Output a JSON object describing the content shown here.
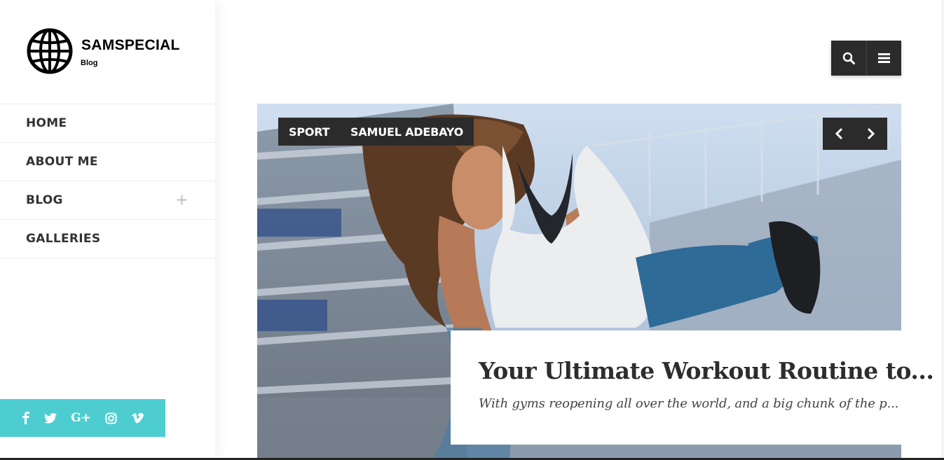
{
  "brand": {
    "name": "SAMSPECIAL",
    "tagline": "Blog"
  },
  "nav": [
    {
      "label": "HOME"
    },
    {
      "label": "ABOUT ME"
    },
    {
      "label": "BLOG",
      "expand_icon": "plus-icon"
    },
    {
      "label": "GALLERIES"
    }
  ],
  "social": [
    {
      "icon": "facebook-icon",
      "glyph": "f"
    },
    {
      "icon": "twitter-icon",
      "glyph": "t"
    },
    {
      "icon": "google-plus-icon",
      "glyph": "G+"
    },
    {
      "icon": "instagram-icon",
      "glyph": "ig"
    },
    {
      "icon": "vimeo-icon",
      "glyph": "v"
    }
  ],
  "header": {
    "search_icon": "search-icon",
    "menu_icon": "menu-icon"
  },
  "slide": {
    "category": "SPORT",
    "author": "SAMUEL ADEBAYO",
    "title": "Your Ultimate Workout Routine to...",
    "excerpt": "With gyms reopening all over the world, and a big chunk of the p..."
  },
  "colors": {
    "accent": "#4ecdd1",
    "dark": "#2b2b2b",
    "text": "#2d2d2d"
  }
}
